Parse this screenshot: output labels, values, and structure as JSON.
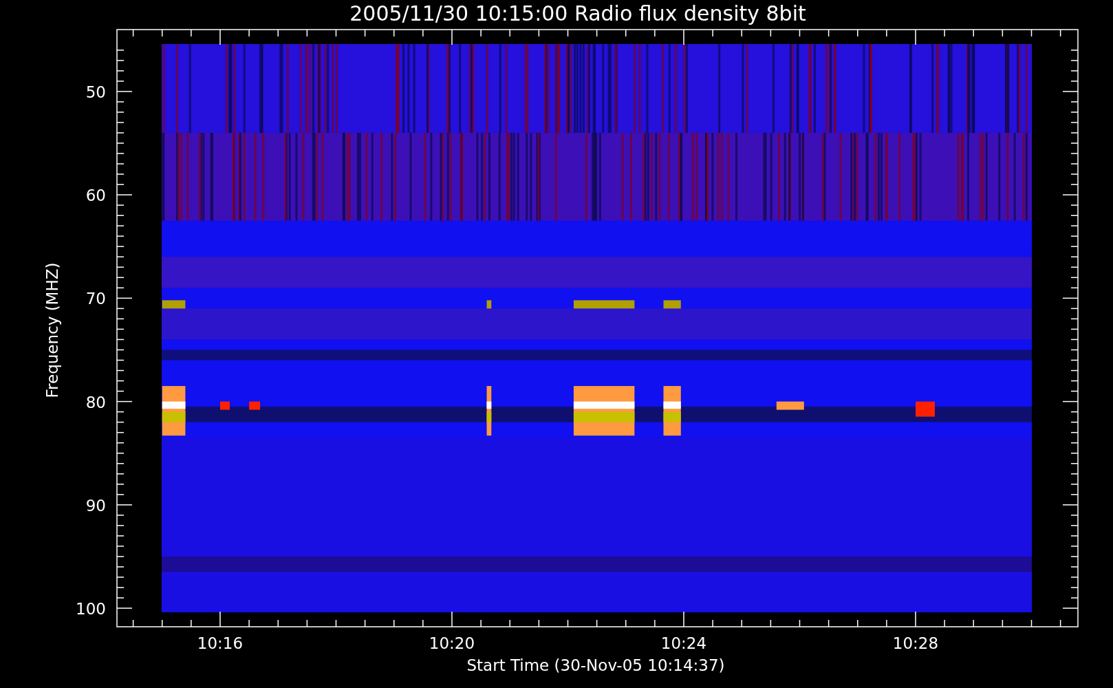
{
  "plot": {
    "title": "2005/11/30 10:15:00 Radio flux density 8bit",
    "ylabel": "Frequency (MHZ)",
    "xlabel": "Start Time (30-Nov-05 10:14:37)",
    "yticks": [
      "50",
      "60",
      "70",
      "80",
      "90",
      "100"
    ],
    "xticks": [
      "10:16",
      "10:20",
      "10:24",
      "10:28"
    ]
  }
}
